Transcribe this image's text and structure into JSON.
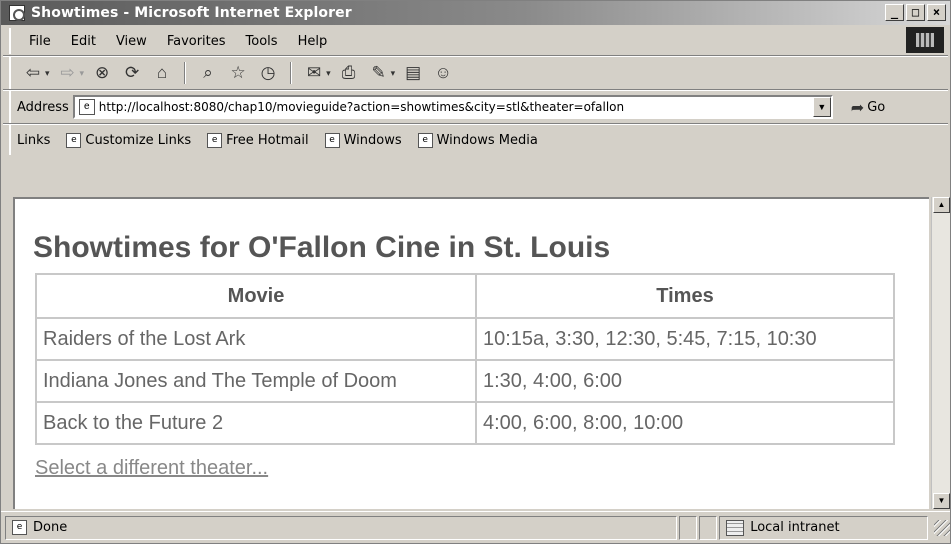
{
  "window": {
    "title": "Showtimes - Microsoft Internet Explorer",
    "controls": {
      "minimize": "_",
      "maximize": "□",
      "close": "×"
    }
  },
  "menu": [
    "File",
    "Edit",
    "View",
    "Favorites",
    "Tools",
    "Help"
  ],
  "toolbar": {
    "icons": [
      "back-icon",
      "forward-icon",
      "stop-icon",
      "refresh-icon",
      "home-icon",
      "search-icon",
      "favorites-icon",
      "history-icon",
      "mail-icon",
      "print-icon",
      "edit-icon",
      "discuss-icon",
      "messenger-icon"
    ]
  },
  "address": {
    "label": "Address",
    "url": "http://localhost:8080/chap10/movieguide?action=showtimes&city=stl&theater=ofallon",
    "go_label": "Go"
  },
  "links": {
    "label": "Links",
    "items": [
      "Customize Links",
      "Free Hotmail",
      "Windows",
      "Windows Media"
    ]
  },
  "page": {
    "heading": "Showtimes for O'Fallon Cine in St. Louis",
    "columns": [
      "Movie",
      "Times"
    ],
    "rows": [
      {
        "movie": "Raiders of the Lost Ark",
        "times": "10:15a, 3:30, 12:30, 5:45, 7:15, 10:30"
      },
      {
        "movie": "Indiana Jones and The Temple of Doom",
        "times": "1:30, 4:00, 6:00"
      },
      {
        "movie": "Back to the Future 2",
        "times": "4:00, 6:00, 8:00, 10:00"
      }
    ],
    "link_text": "Select a different theater..."
  },
  "status": {
    "text": "Done",
    "zone": "Local intranet"
  }
}
